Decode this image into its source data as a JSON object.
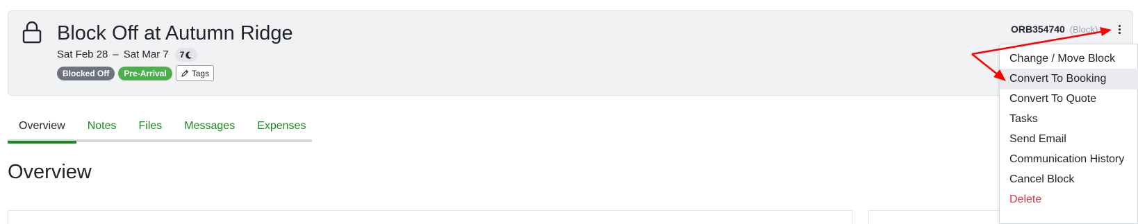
{
  "header": {
    "title": "Block Off at Autumn Ridge",
    "start_date": "Sat Feb 28",
    "date_separator": "–",
    "end_date": "Sat Mar 7",
    "nights": "7",
    "badges": [
      {
        "label": "Blocked Off",
        "color": "#6c757d"
      },
      {
        "label": "Pre-Arrival",
        "color": "#4cae4c"
      }
    ],
    "tags_label": "Tags",
    "ref_code": "ORB354740",
    "ref_type": "(Block)"
  },
  "tabs": [
    {
      "label": "Overview",
      "active": true
    },
    {
      "label": "Notes",
      "active": false
    },
    {
      "label": "Files",
      "active": false
    },
    {
      "label": "Messages",
      "active": false
    },
    {
      "label": "Expenses",
      "active": false
    }
  ],
  "section_title": "Overview",
  "menu": {
    "items": [
      {
        "label": "Change / Move Block",
        "state": "normal"
      },
      {
        "label": "Convert To Booking",
        "state": "highlighted"
      },
      {
        "label": "Convert To Quote",
        "state": "normal"
      },
      {
        "label": "Tasks",
        "state": "normal"
      },
      {
        "label": "Send Email",
        "state": "normal"
      },
      {
        "label": "Communication History",
        "state": "normal"
      },
      {
        "label": "Cancel Block",
        "state": "normal"
      },
      {
        "label": "Delete",
        "state": "danger"
      }
    ]
  },
  "colors": {
    "accent_green": "#1a8a1a",
    "danger": "#dc3545",
    "annotation_arrow": "#ff0000"
  }
}
